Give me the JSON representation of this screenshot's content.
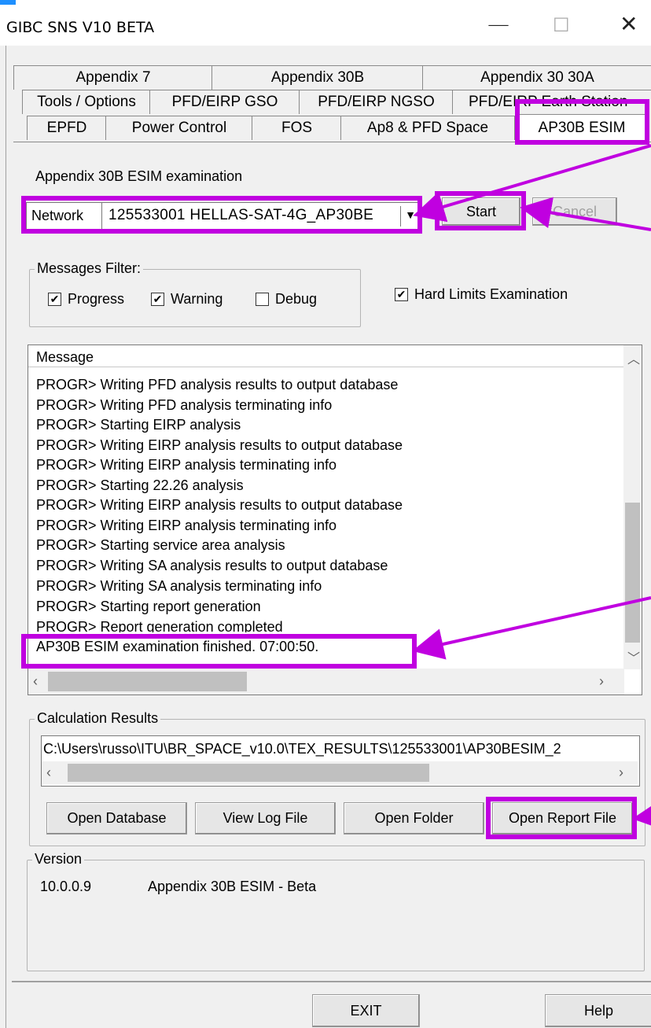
{
  "window": {
    "title": "GIBC SNS V10 BETA",
    "minimize": "—",
    "maximize": "☐",
    "close": "✕"
  },
  "tabs": {
    "row1": [
      "Appendix 7",
      "Appendix 30B",
      "Appendix 30 30A"
    ],
    "row2": [
      "Tools / Options",
      "PFD/EIRP GSO",
      "PFD/EIRP NGSO",
      "PFD/EIRP Earth Station"
    ],
    "row3": [
      "EPFD",
      "Power Control",
      "FOS",
      "Ap8 & PFD Space",
      "AP30B ESIM"
    ]
  },
  "examination": {
    "heading": "Appendix 30B ESIM examination",
    "network_label": "Network",
    "network_value": "125533001  HELLAS-SAT-4G_AP30BE",
    "start_label": "Start",
    "cancel_label": "Cancel"
  },
  "filter": {
    "legend": "Messages Filter:",
    "progress": "Progress",
    "warning": "Warning",
    "debug": "Debug",
    "progress_checked": true,
    "warning_checked": true,
    "debug_checked": false,
    "hard_limits": "Hard Limits Examination",
    "hard_limits_checked": true
  },
  "messages": {
    "header": "Message",
    "rows": [
      "PROGR> Writing PFD analysis results to output database",
      "PROGR> Writing PFD analysis terminating info",
      "PROGR> Starting EIRP analysis",
      "PROGR> Writing EIRP analysis results to output database",
      "PROGR> Writing EIRP analysis terminating info",
      "PROGR> Starting 22.26 analysis",
      "PROGR> Writing EIRP analysis results to output database",
      "PROGR> Writing EIRP analysis terminating info",
      "PROGR> Starting service area analysis",
      "PROGR> Writing SA analysis results to output database",
      "PROGR> Writing SA analysis terminating info",
      "PROGR> Starting report generation",
      "PROGR> Report generation completed",
      "AP30B ESIM examination finished. 07:00:50."
    ]
  },
  "results": {
    "legend": "Calculation Results",
    "path": "C:\\Users\\russo\\ITU\\BR_SPACE_v10.0\\TEX_RESULTS\\125533001\\AP30BESIM_2",
    "open_database": "Open Database",
    "view_log": "View Log File",
    "open_folder": "Open Folder",
    "open_report": "Open Report File"
  },
  "version": {
    "legend": "Version",
    "number": "10.0.0.9",
    "description": "Appendix 30B ESIM - Beta"
  },
  "footer": {
    "exit": "EXIT",
    "help": "Help"
  },
  "colors": {
    "highlight": "#c000e0",
    "accent": "#1e90ff"
  }
}
